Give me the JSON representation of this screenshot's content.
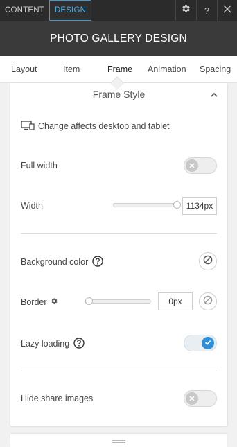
{
  "topbar": {
    "tabs": [
      {
        "label": "CONTENT",
        "active": false
      },
      {
        "label": "DESIGN",
        "active": true
      }
    ],
    "help_glyph": "?",
    "icons": [
      "gear-icon",
      "help-icon",
      "close-icon"
    ]
  },
  "header": {
    "title": "PHOTO GALLERY DESIGN"
  },
  "subnav": {
    "items": [
      {
        "label": "Layout"
      },
      {
        "label": "Item"
      },
      {
        "label": "Frame",
        "active": true
      },
      {
        "label": "Animation"
      },
      {
        "label": "Spacing"
      }
    ]
  },
  "frame_style": {
    "title": "Frame Style",
    "note": "Change affects desktop and tablet",
    "full_width": {
      "label": "Full width",
      "enabled": false
    },
    "width": {
      "label": "Width",
      "value": "1134px",
      "slider_fraction": 1.0
    },
    "background_color": {
      "label": "Background color"
    },
    "border": {
      "label": "Border",
      "value": "0px",
      "slider_fraction": 0.0
    },
    "lazy_loading": {
      "label": "Lazy loading",
      "enabled": true
    },
    "hide_share_images": {
      "label": "Hide share images",
      "enabled": false
    }
  },
  "colors": {
    "accent": "#2f8fd8",
    "topbar": "#2b2b2b",
    "header": "#3a3a3a",
    "panel_bg": "#f1f1f1"
  }
}
